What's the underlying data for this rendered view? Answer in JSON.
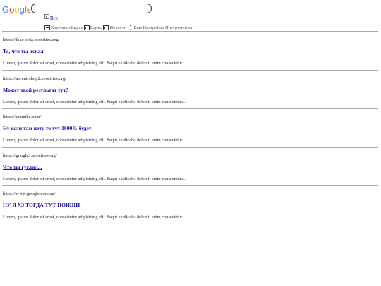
{
  "logo": {
    "text": "Google",
    "letters": [
      "G",
      "o",
      "o",
      "g",
      "l",
      "e"
    ],
    "colors": [
      "#4285F4",
      "#EA4335",
      "#FBBC05",
      "#4285F4",
      "#34A853",
      "#EA4335"
    ]
  },
  "search": {
    "value": "",
    "placeholder": ""
  },
  "tabs": {
    "all": "Все",
    "images": "Картинки",
    "video": "Видео",
    "maps": "Карты",
    "news": "Новости",
    "more": "Еще",
    "settings": "Настройки",
    "tools": "Инструменты"
  },
  "results": [
    {
      "url": "https://fake-cola.neocities.org/",
      "title": "То, что ты искал",
      "snippet": "Lorem, ipsum dolor sit amet, consectetur adipisicing elit. Sequi explicabo deleniti enim consectetur..."
    },
    {
      "url": "https://ascent-shop2.neocities.org/",
      "title": "Может твой результат тут?",
      "snippet": "Lorem, ipsum dolor sit amet, consectetur adipisicing elit. Sequi explicabo deleniti enim consectetur..."
    },
    {
      "url": "https://youtube.com/",
      "title": "Ну если там нету то тут 1000% будет",
      "snippet": "Lorem, ipsum dolor sit amet, consectetur adipisicing elit. Sequi explicabo deleniti enim consectetur..."
    },
    {
      "url": "https://google3.neocities.org/",
      "title": "Что ты гуглил...",
      "snippet": "Lorem, ipsum dolor sit amet, consectetur adipisicing elit. Sequi explicabo deleniti enim consectetur..."
    },
    {
      "url": "https://www.google.com.ua/",
      "title": "НУ Я ХЗ ТОГДА ТУТ ПОИЩИ",
      "snippet": "Lorem, ipsum dolor sit amet, consectetur adipisicing elit. Sequi explicabo deleniti enim consectetur..."
    }
  ],
  "colors": {
    "link": "#1a0dab",
    "text": "#202124",
    "muted": "#5f6368",
    "divider": "#aaaaaa"
  }
}
